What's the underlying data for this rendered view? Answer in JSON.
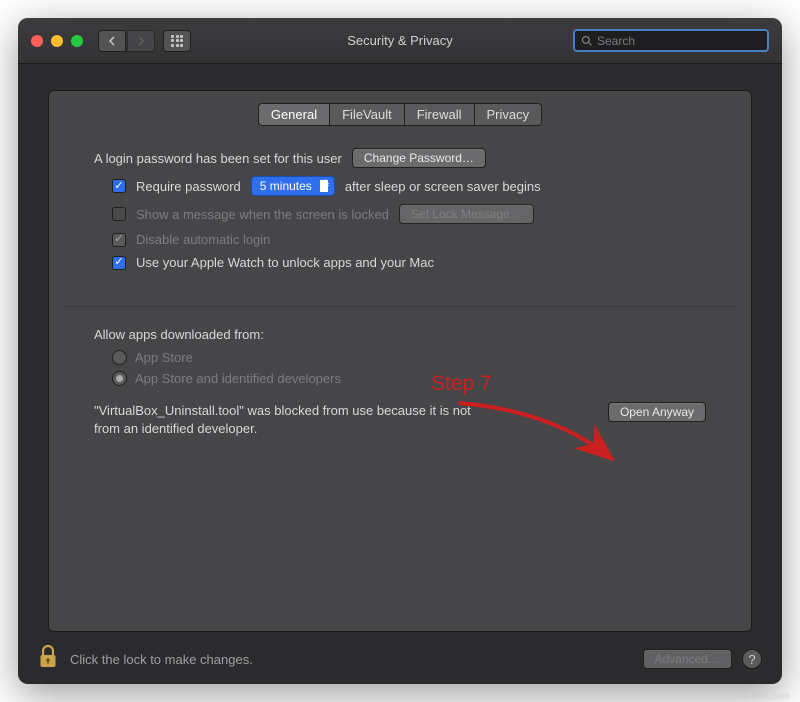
{
  "window": {
    "title": "Security & Privacy",
    "search_placeholder": "Search"
  },
  "tabs": [
    {
      "label": "General",
      "active": true
    },
    {
      "label": "FileVault",
      "active": false
    },
    {
      "label": "Firewall",
      "active": false
    },
    {
      "label": "Privacy",
      "active": false
    }
  ],
  "login": {
    "password_set_text": "A login password has been set for this user",
    "change_password_btn": "Change Password…",
    "require_password_label": "Require password",
    "require_password_delay": "5 minutes",
    "after_sleep_text": "after sleep or screen saver begins",
    "show_message_label": "Show a message when the screen is locked",
    "set_lock_msg_btn": "Set Lock Message…",
    "disable_auto_login_label": "Disable automatic login",
    "apple_watch_label": "Use your Apple Watch to unlock apps and your Mac"
  },
  "allow_apps": {
    "heading": "Allow apps downloaded from:",
    "option_app_store": "App Store",
    "option_identified": "App Store and identified developers",
    "blocked_text": "\"VirtualBox_Uninstall.tool\" was blocked from use because it is not from an identified developer.",
    "open_anyway_btn": "Open Anyway"
  },
  "footer": {
    "lock_text": "Click the lock to make changes.",
    "advanced_btn": "Advanced…"
  },
  "annotation": {
    "label": "Step 7"
  },
  "watermark": "wsxdn.com"
}
